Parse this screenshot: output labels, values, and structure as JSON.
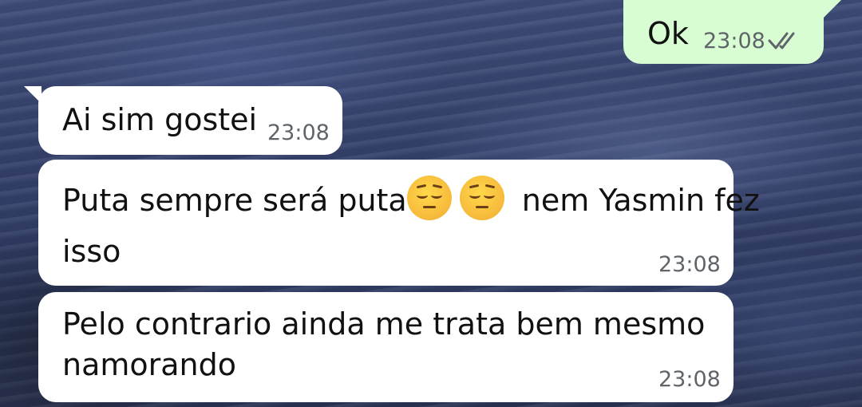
{
  "colors": {
    "incoming_bubble": "#ffffff",
    "outgoing_bubble": "#d9fdd3",
    "timestamp": "#5e6469",
    "read_ticks": "#5e6469"
  },
  "messages": [
    {
      "direction": "outgoing",
      "text": "Ok",
      "time": "23:08",
      "status_icon": "double-check-icon"
    },
    {
      "direction": "incoming",
      "text": "Ai sim gostei",
      "time": "23:08"
    },
    {
      "direction": "incoming",
      "text_before_emoji": "Puta sempre será puta",
      "emojis": [
        "pensive-face-emoji",
        "pensive-face-emoji"
      ],
      "text_after_emoji": " nem Yasmin fez",
      "text_line2": "isso",
      "time": "23:08"
    },
    {
      "direction": "incoming",
      "text_line1": "Pelo contrario ainda me trata bem mesmo",
      "text_line2": "namorando",
      "time": "23:08"
    }
  ]
}
